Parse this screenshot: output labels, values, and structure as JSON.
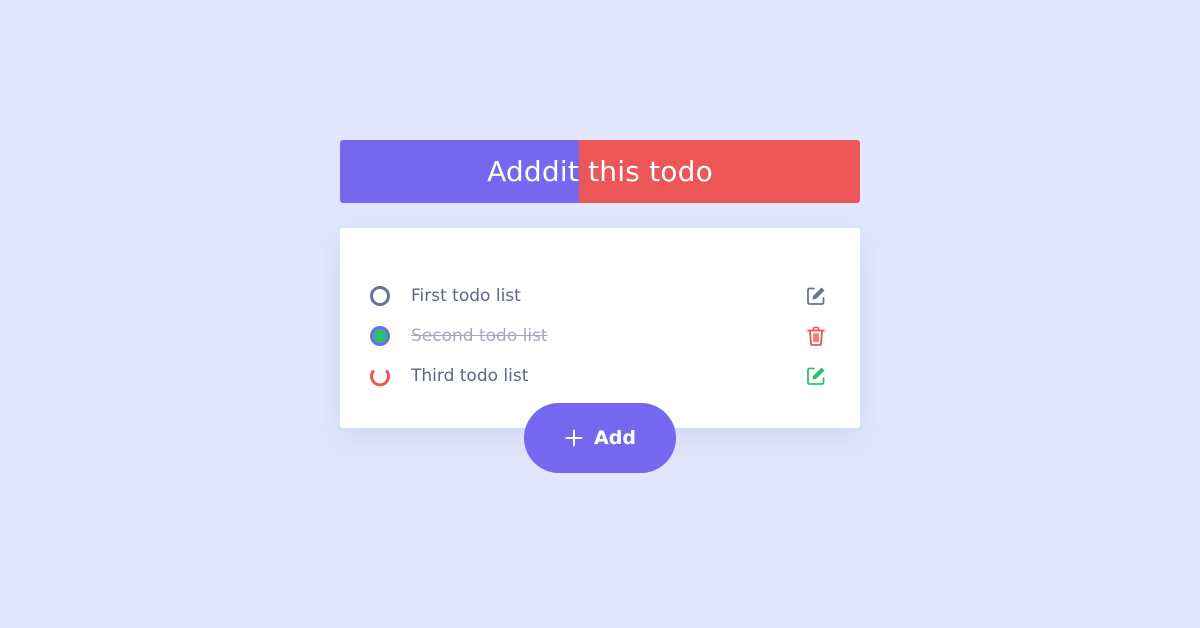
{
  "header": {
    "text_left": "Add",
    "text_right": "dit this todo",
    "colors": {
      "left": "#7468f0",
      "right": "#ec5656"
    }
  },
  "todos": [
    {
      "label": "First todo list",
      "status": "unchecked",
      "action_icon": "edit-icon",
      "action_color": "#6b7394"
    },
    {
      "label": "Second todo list",
      "status": "completed",
      "action_icon": "trash-icon",
      "action_color": "#ec5656"
    },
    {
      "label": "Third todo list",
      "status": "loading",
      "action_icon": "edit-icon",
      "action_color": "#2fbf71"
    }
  ],
  "add_button": {
    "label": "Add",
    "icon": "plus-icon"
  },
  "colors": {
    "background": "#e2e7fe",
    "accent": "#7468f0",
    "danger": "#ec5656",
    "success": "#2fbf71",
    "text": "#5d6685"
  }
}
